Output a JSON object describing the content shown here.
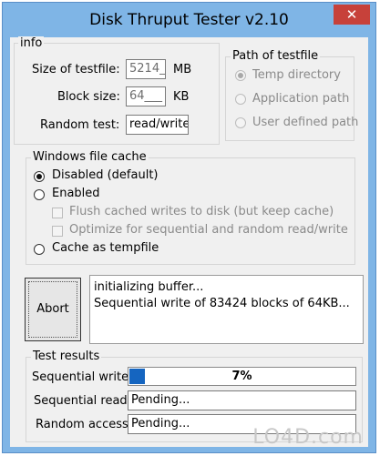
{
  "window": {
    "title": "Disk Thruput Tester v2.10",
    "close_glyph": "✕"
  },
  "info": {
    "legend": "info",
    "size_label": "Size of testfile:",
    "size_value": "5214_",
    "size_unit": "MB",
    "block_label": "Block size:",
    "block_value": "64___",
    "block_unit": "KB",
    "random_label": "Random test:",
    "random_value": "read/write"
  },
  "path": {
    "legend": "Path of testfile",
    "options": [
      "Temp directory",
      "Application path",
      "User defined path"
    ],
    "selected": 0
  },
  "cache": {
    "legend": "Windows file cache",
    "disabled_label": "Disabled (default)",
    "enabled_label": "Enabled",
    "flush_label": "Flush cached writes to disk (but keep cache)",
    "optimize_label": "Optimize for sequential and random read/write",
    "tempfile_label": "Cache as tempfile"
  },
  "actions": {
    "abort_label": "Abort"
  },
  "log": {
    "lines": [
      "initializing buffer...",
      "Sequential write of 83424 blocks of 64KB..."
    ]
  },
  "results": {
    "legend": "Test results",
    "seq_write_label": "Sequential write:",
    "seq_write_progress": 0.07,
    "seq_write_text": "7%",
    "seq_read_label": "Sequential read:",
    "seq_read_value": "Pending...",
    "random_label": "Random access:",
    "random_value": "Pending..."
  },
  "watermark": "LO4D.com"
}
